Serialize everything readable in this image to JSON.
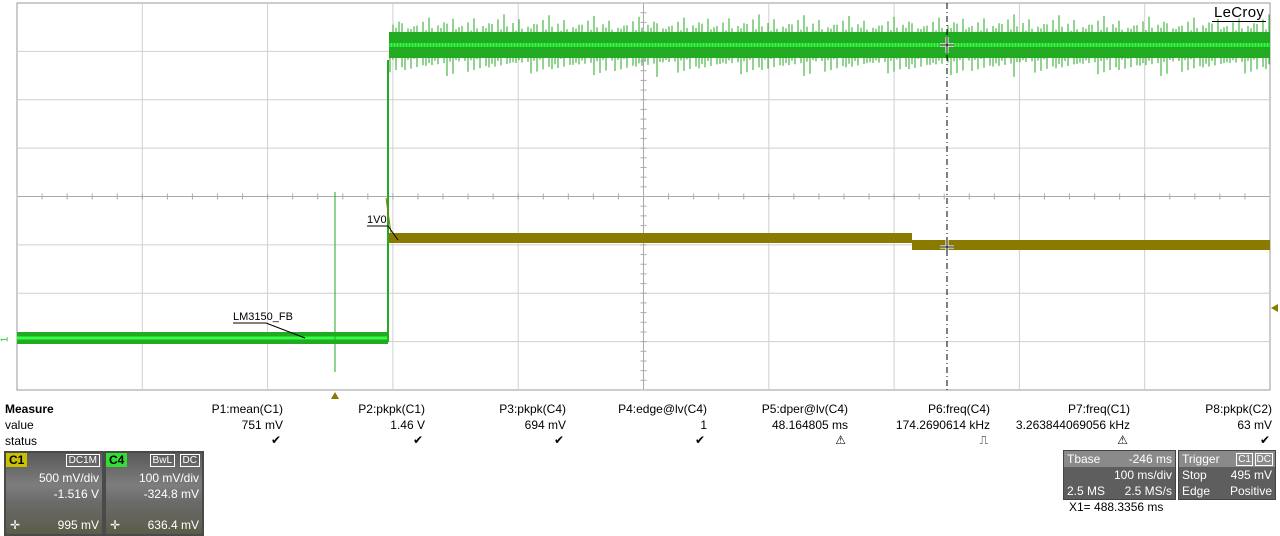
{
  "brand": "LeCroy",
  "trace_labels": {
    "c4": "1V0",
    "c1": "LM3150_FB"
  },
  "side_markers": {
    "left_channel": "1"
  },
  "measure": {
    "title": "Measure",
    "row_value": "value",
    "row_status": "status",
    "columns": [
      {
        "name": "P1:mean(C1)",
        "value": "751 mV",
        "status": "check"
      },
      {
        "name": "P2:pkpk(C1)",
        "value": "1.46 V",
        "status": "check"
      },
      {
        "name": "P3:pkpk(C4)",
        "value": "694 mV",
        "status": "check"
      },
      {
        "name": "P4:edge@lv(C4)",
        "value": "1",
        "status": "check"
      },
      {
        "name": "P5:dper@lv(C4)",
        "value": "48.164805 ms",
        "status": "warning"
      },
      {
        "name": "P6:freq(C4)",
        "value": "174.2690614 kHz",
        "status": "pulse"
      },
      {
        "name": "P7:freq(C1)",
        "value": "3.263844069056 kHz",
        "status": "warning"
      },
      {
        "name": "P8:pkpk(C2)",
        "value": "63 mV",
        "status": "check"
      }
    ]
  },
  "status_glyphs": {
    "check": "✔",
    "warning": "⚠",
    "pulse": "⎍"
  },
  "channels": [
    {
      "tag": "C1",
      "mode": "DC1M",
      "scale": "500 mV/div",
      "offset": "-1.516 V",
      "pin": "995 mV",
      "color": "#c8c000"
    },
    {
      "tag": "C4",
      "mode_a": "BwL",
      "mode_b": "DC",
      "scale": "100 mV/div",
      "offset": "-324.8 mV",
      "pin": "636.4 mV",
      "color": "#33dd33"
    }
  ],
  "timebase": {
    "label": "Tbase",
    "delay": "-246 ms",
    "scale": "100 ms/div",
    "samples": "2.5 MS",
    "rate": "2.5 MS/s"
  },
  "trigger": {
    "label": "Trigger",
    "src": "C1",
    "coupling": "DC",
    "mode": "Stop",
    "level": "495 mV",
    "type": "Edge",
    "slope": "Positive"
  },
  "cursor": {
    "readout": "X1=  488.3356 ms"
  },
  "colors": {
    "c1_trace": "#22aa22",
    "c1_bright": "#33ff44",
    "c4_trace": "#8a7a00",
    "c4_bright": "#c8b400",
    "grid": "#cfcfcf"
  }
}
